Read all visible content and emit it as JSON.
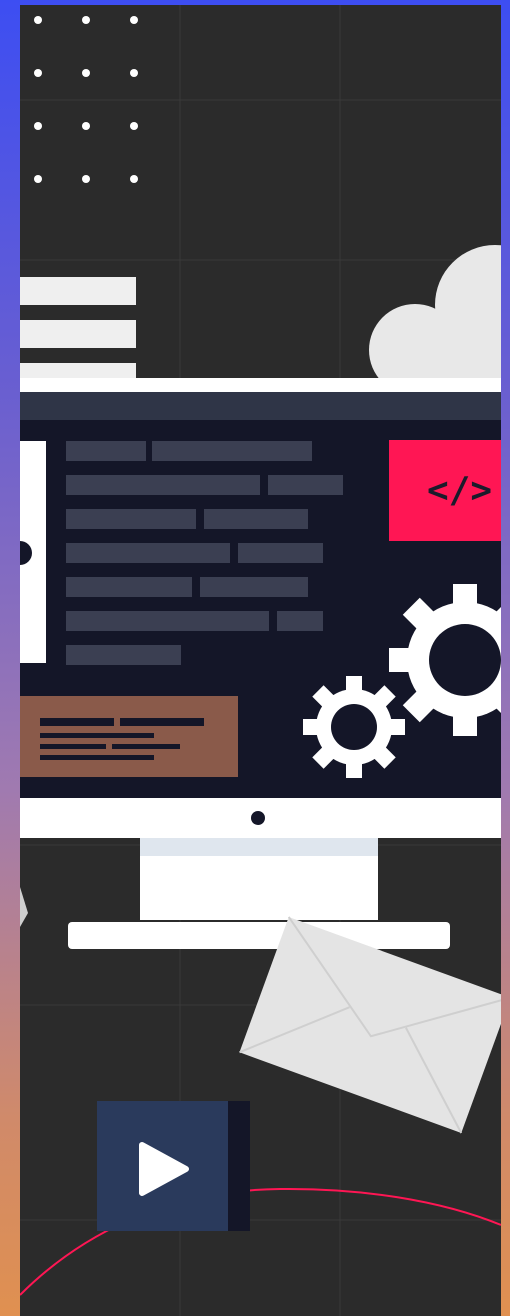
{
  "illustration": {
    "code_tag_text": "</>",
    "colors": {
      "frame_gradient_top": "#3d4ef2",
      "frame_gradient_bottom": "#e09050",
      "background": "#2b2b2b",
      "screen": "#141628",
      "code_badge": "#ff1654",
      "note_card": "#8a5a4a",
      "play_button": "#2a3a5c",
      "accent_line": "#ff1654"
    },
    "icons": [
      "dot-grid",
      "menu-bars",
      "cloud-icon",
      "monitor",
      "code-tag-icon",
      "gear-icon",
      "envelope-icon",
      "play-icon"
    ]
  }
}
